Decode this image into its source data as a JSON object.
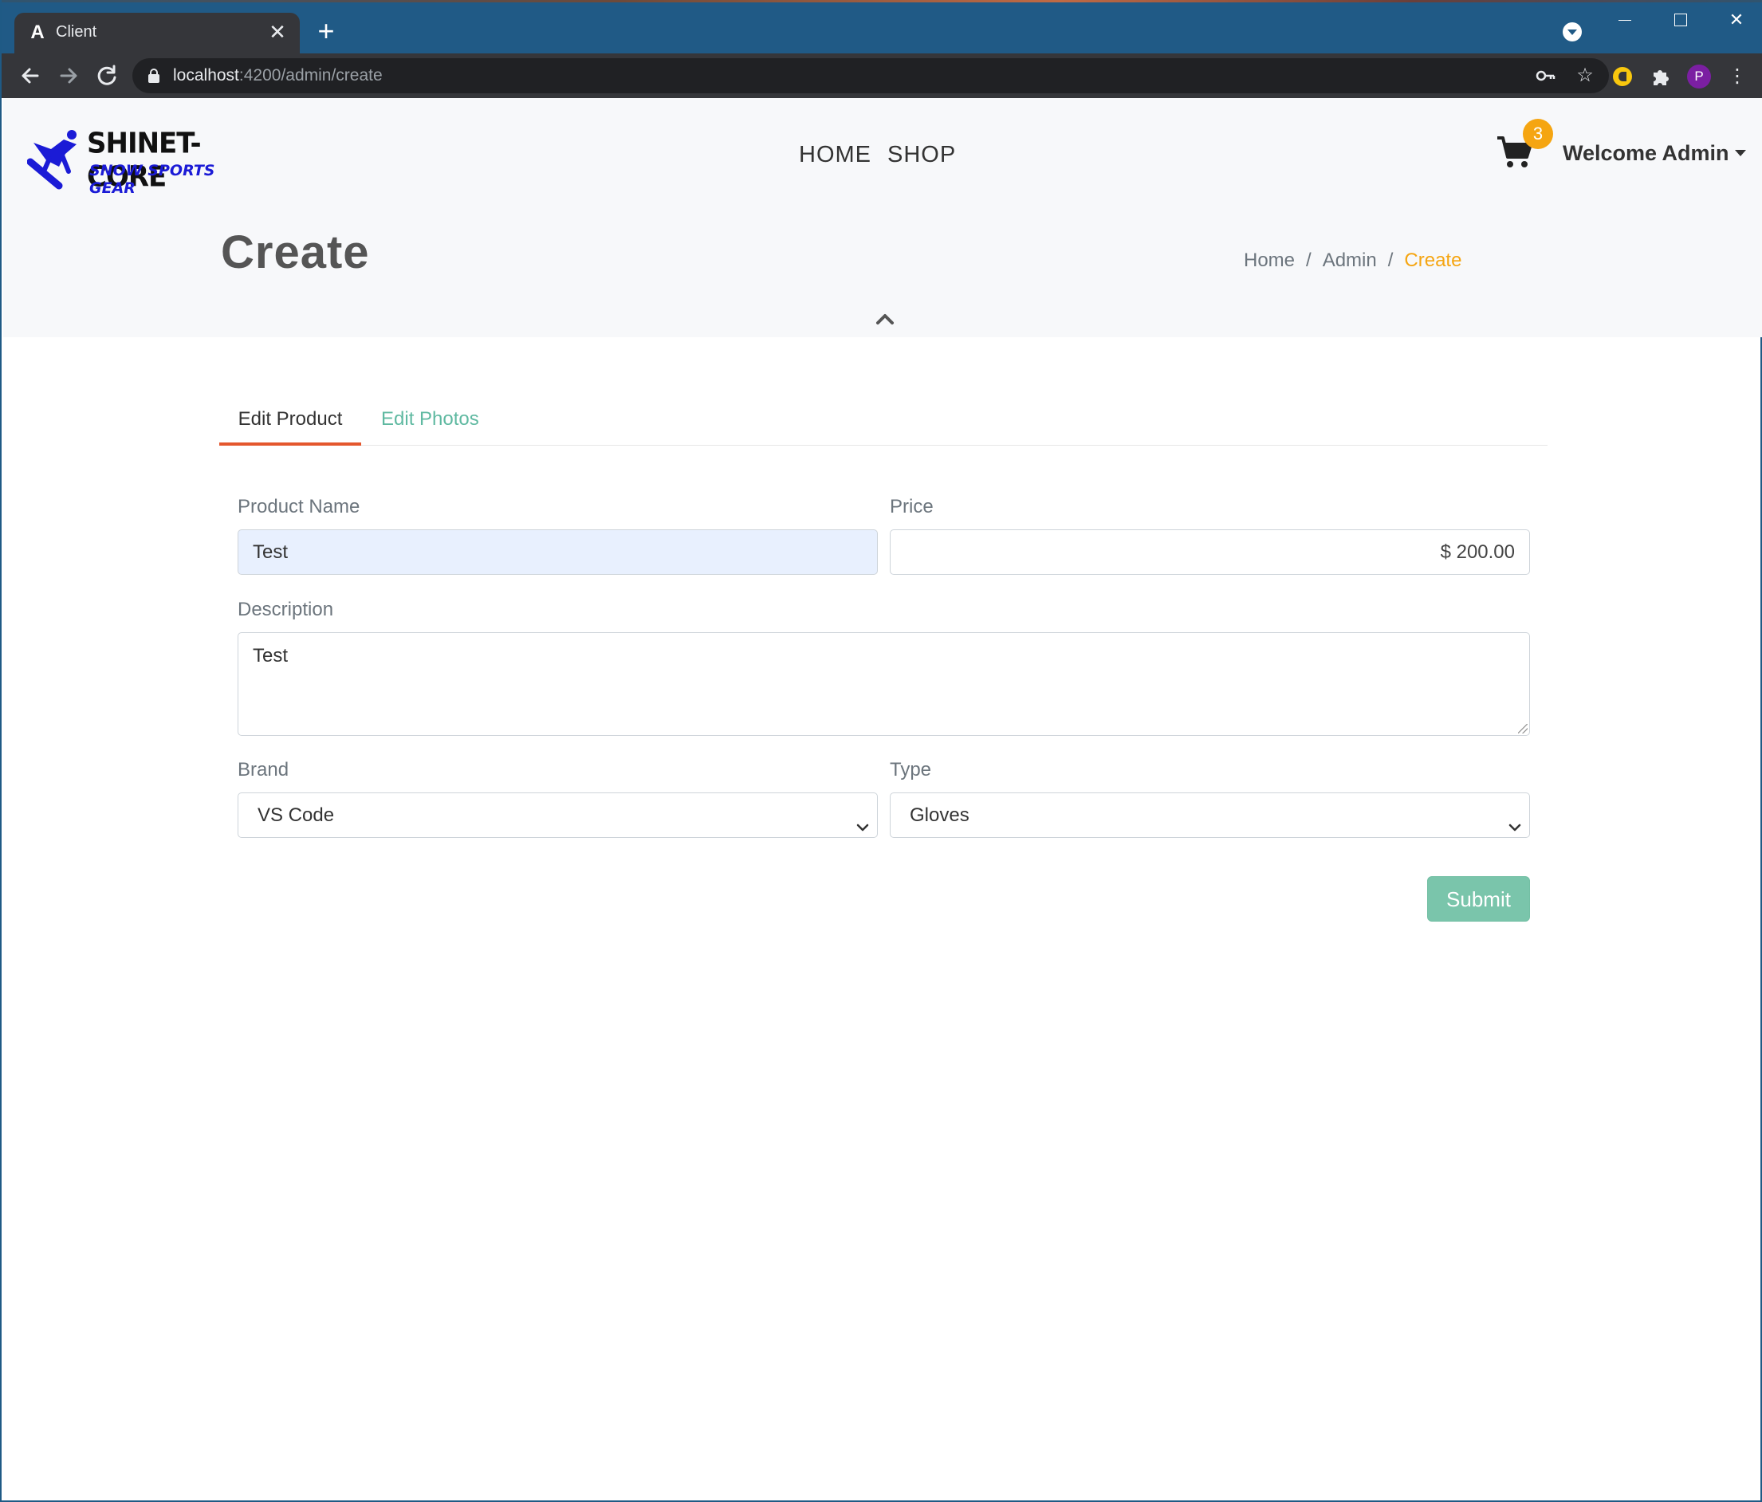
{
  "browser": {
    "tab_title": "Client",
    "tab_favicon": "A",
    "url_host": "localhost",
    "url_path": ":4200/admin/create",
    "profile_initial": "P",
    "icons": [
      "back-arrow-icon",
      "forward-arrow-icon",
      "reload-icon",
      "lock-icon",
      "key-icon",
      "star-icon",
      "puzzle-icon",
      "kebab-menu-icon"
    ]
  },
  "header": {
    "logo_line1": "SHINET-CORE",
    "logo_line2": "SNOW SPORTS GEAR",
    "nav": [
      "HOME",
      "SHOP"
    ],
    "cart_count": "3",
    "welcome": "Welcome Admin"
  },
  "page": {
    "title": "Create",
    "breadcrumb": [
      "Home",
      "Admin",
      "Create"
    ]
  },
  "tabs": [
    "Edit Product",
    "Edit Photos"
  ],
  "form": {
    "product_name_label": "Product Name",
    "product_name_value": "Test",
    "price_label": "Price",
    "price_value": "$ 200.00",
    "description_label": "Description",
    "description_value": "Test",
    "brand_label": "Brand",
    "brand_value": "VS Code",
    "type_label": "Type",
    "type_value": "Gloves",
    "submit_label": "Submit"
  },
  "colors": {
    "accent_orange": "#f5a511",
    "tab_active_underline": "#e4572e",
    "tab_link_green": "#5fb9a1",
    "submit_bg": "#7ac5ab",
    "autofill_bg": "#e8f0fe"
  }
}
